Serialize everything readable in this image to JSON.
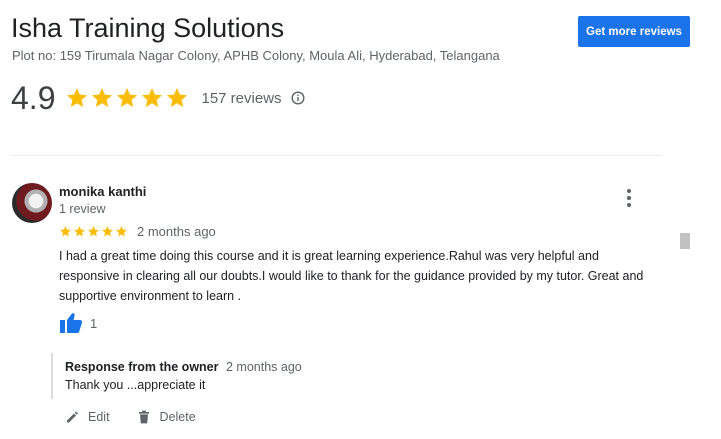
{
  "business": {
    "name": "Isha Training Solutions",
    "address": "Plot no: 159 Tirumala Nagar Colony, APHB Colony, Moula Ali, Hyderabad, Telangana",
    "rating": "4.9",
    "review_count": "157 reviews",
    "get_reviews_label": "Get more reviews",
    "stars": 5
  },
  "review": {
    "author": "monika kanthi",
    "author_meta": "1 review",
    "stars": 5,
    "date": "2 months ago",
    "text": "I had a great time doing this course and it is great learning experience.Rahul was very helpful and responsive in clearing all our doubts.I would like to thank  for the guidance provided by my tutor. Great and supportive environment to learn .",
    "likes": "1"
  },
  "owner_response": {
    "title": "Response from the owner",
    "date": "2 months ago",
    "text": "Thank you ...appreciate it"
  },
  "actions": {
    "edit_label": "Edit",
    "delete_label": "Delete"
  },
  "colors": {
    "accent": "#1a73e8",
    "star": "#fbbc04",
    "muted": "#5f6368"
  },
  "icons": {
    "rating_star": "star-icon",
    "info": "info-icon",
    "menu": "more-vert-icon",
    "like": "thumbs-up-icon",
    "edit": "pencil-icon",
    "delete": "trash-icon"
  }
}
